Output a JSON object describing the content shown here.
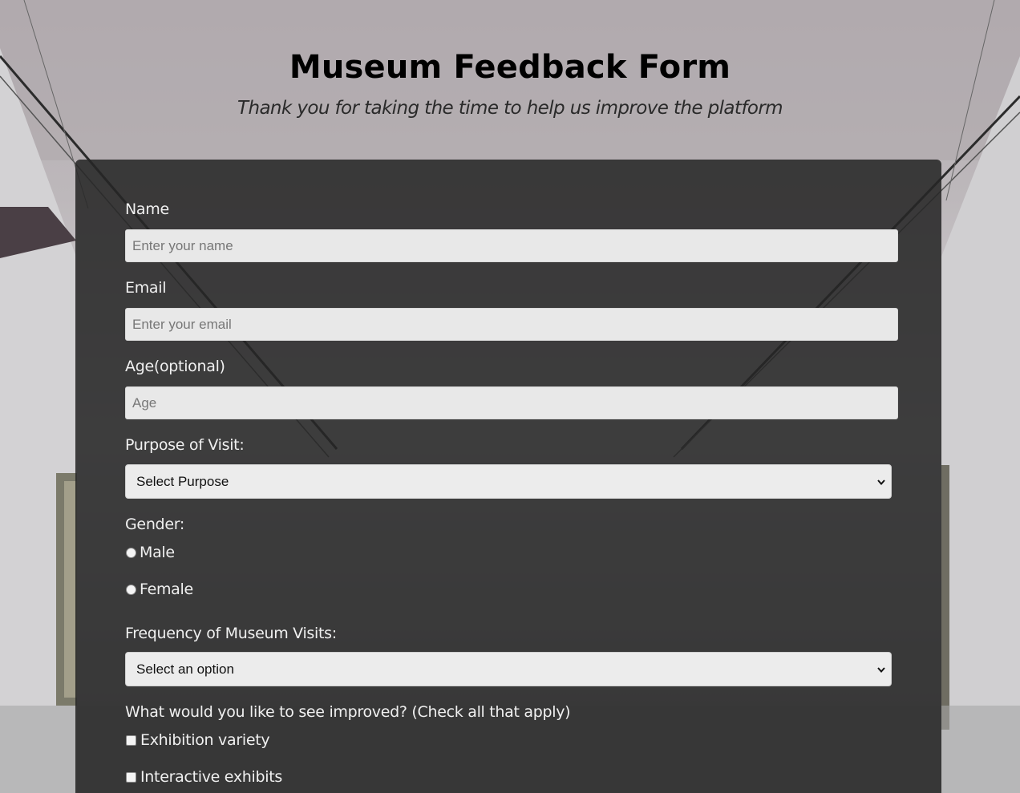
{
  "header": {
    "title": "Museum Feedback Form",
    "subtitle": "Thank you for taking the time to help us improve the platform"
  },
  "form": {
    "name": {
      "label": "Name",
      "placeholder": "Enter your name",
      "value": ""
    },
    "email": {
      "label": "Email",
      "placeholder": "Enter your email",
      "value": ""
    },
    "age": {
      "label": "Age(optional)",
      "placeholder": "Age",
      "value": ""
    },
    "purpose": {
      "label": "Purpose of Visit:",
      "selected": "Select Purpose"
    },
    "gender": {
      "label": "Gender:",
      "options": [
        "Male",
        "Female"
      ]
    },
    "frequency": {
      "label": "Frequency of Museum Visits:",
      "selected": "Select an option"
    },
    "improvements": {
      "label": "What would you like to see improved? (Check all that apply)",
      "options": [
        "Exhibition variety",
        "Interactive exhibits"
      ]
    }
  }
}
